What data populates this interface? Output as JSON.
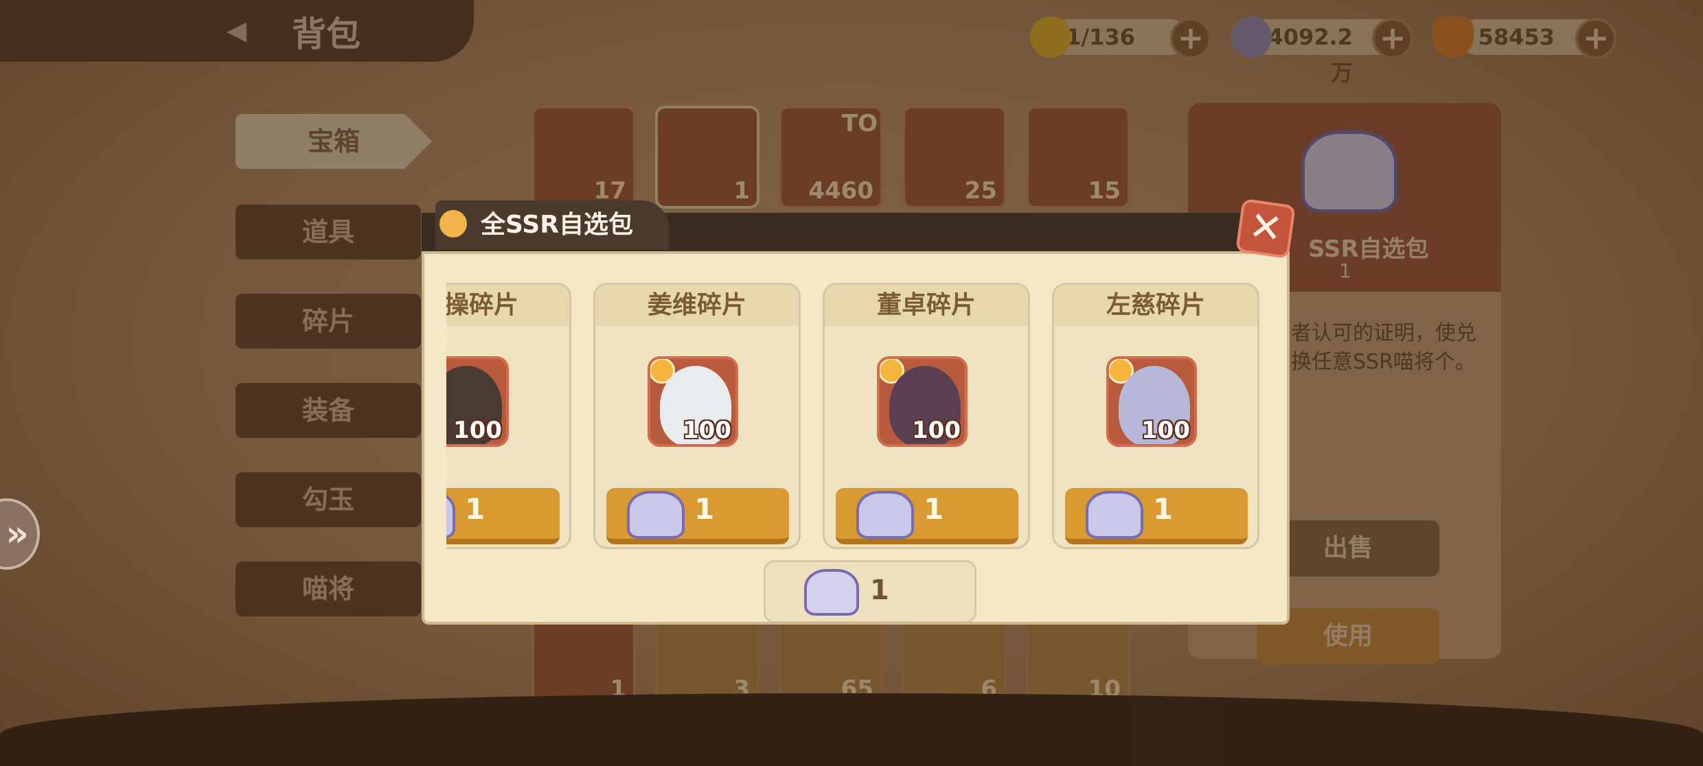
{
  "header": {
    "title": "背包",
    "energy": "71/136",
    "coins": "4092.2万",
    "ingots": "58453"
  },
  "sidebar": {
    "tabs": [
      {
        "label": "宝箱",
        "active": true
      },
      {
        "label": "道具",
        "active": false
      },
      {
        "label": "碎片",
        "active": false
      },
      {
        "label": "装备",
        "active": false
      },
      {
        "label": "勾玉",
        "active": false
      },
      {
        "label": "喵将",
        "active": false
      }
    ]
  },
  "inventory": {
    "top_row_counts": [
      "17",
      "1",
      "4460",
      "25",
      "15"
    ],
    "top_row_extra": "TO",
    "bottom_row_counts": [
      "1",
      "3",
      "65",
      "6",
      "10"
    ]
  },
  "detail": {
    "name": "SSR自选包",
    "count": "1",
    "description": "者认可的证明，使兑换任意SSR喵将个。",
    "sell_label": "出售",
    "use_label": "使用"
  },
  "modal": {
    "title": "全SSR自选包",
    "close_symbol": "✕",
    "cards": [
      {
        "name": "操碎片",
        "quantity": "100",
        "cost": "1"
      },
      {
        "name": "姜维碎片",
        "quantity": "100",
        "cost": "1"
      },
      {
        "name": "董卓碎片",
        "quantity": "100",
        "cost": "1"
      },
      {
        "name": "左慈碎片",
        "quantity": "100",
        "cost": "1"
      }
    ],
    "owned_count": "1"
  },
  "colors": {
    "modal_bg": "#f3e7c6",
    "card_title_bg": "#e6d7ae",
    "cost_button": "#d99a32",
    "close_button": "#c5543c"
  },
  "icons": {
    "energy": "lightning-icon",
    "coins": "coin-icon",
    "ingots": "gold-ingot-icon",
    "chest": "ssr-chest-icon"
  }
}
